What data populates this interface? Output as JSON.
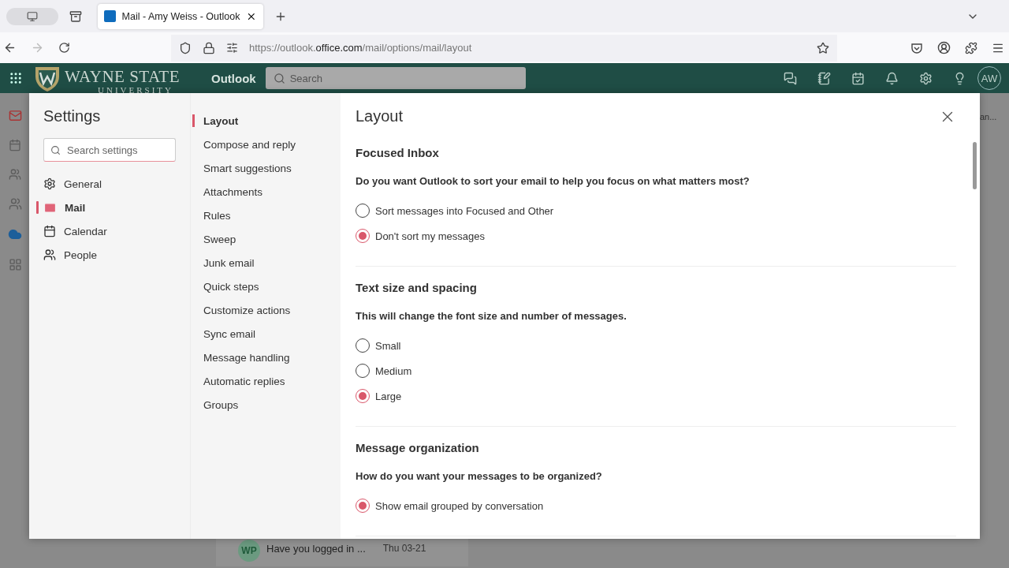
{
  "browser": {
    "tab_title": "Mail - Amy Weiss - Outlook",
    "url_prefix": "https://outlook.",
    "url_domain": "office.com",
    "url_path": "/mail/options/mail/layout"
  },
  "app_bar": {
    "org_line1": "WAYNE STATE",
    "org_line2": "UNIVERSITY",
    "app_name": "Outlook",
    "search_placeholder": "Search",
    "avatar": "AW"
  },
  "background": {
    "message_initials": "WP",
    "message_subject": "Have you logged in ...",
    "message_date": "Thu 03-21",
    "peek_text": "an..."
  },
  "settings": {
    "title": "Settings",
    "search_placeholder": "Search settings",
    "categories": [
      {
        "kind": "general",
        "label": "General",
        "selected": false
      },
      {
        "kind": "mail",
        "label": "Mail",
        "selected": true
      },
      {
        "kind": "calendar",
        "label": "Calendar",
        "selected": false
      },
      {
        "kind": "people",
        "label": "People",
        "selected": false
      }
    ],
    "subsections": [
      {
        "label": "Layout",
        "selected": true
      },
      {
        "label": "Compose and reply",
        "selected": false
      },
      {
        "label": "Smart suggestions",
        "selected": false
      },
      {
        "label": "Attachments",
        "selected": false
      },
      {
        "label": "Rules",
        "selected": false
      },
      {
        "label": "Sweep",
        "selected": false
      },
      {
        "label": "Junk email",
        "selected": false
      },
      {
        "label": "Quick steps",
        "selected": false
      },
      {
        "label": "Customize actions",
        "selected": false
      },
      {
        "label": "Sync email",
        "selected": false
      },
      {
        "label": "Message handling",
        "selected": false
      },
      {
        "label": "Automatic replies",
        "selected": false
      },
      {
        "label": "Groups",
        "selected": false
      }
    ],
    "page_title": "Layout",
    "sections": [
      {
        "title": "Focused Inbox",
        "question": "Do you want Outlook to sort your email to help you focus on what matters most?",
        "options": [
          {
            "label": "Sort messages into Focused and Other",
            "selected": false
          },
          {
            "label": "Don't sort my messages",
            "selected": true
          }
        ]
      },
      {
        "title": "Text size and spacing",
        "question": "This will change the font size and number of messages.",
        "options": [
          {
            "label": "Small",
            "selected": false
          },
          {
            "label": "Medium",
            "selected": false
          },
          {
            "label": "Large",
            "selected": true
          }
        ]
      },
      {
        "title": "Message organization",
        "question": "How do you want your messages to be organized?",
        "options": [
          {
            "label": "Show email grouped by conversation",
            "selected": true
          }
        ]
      }
    ]
  }
}
